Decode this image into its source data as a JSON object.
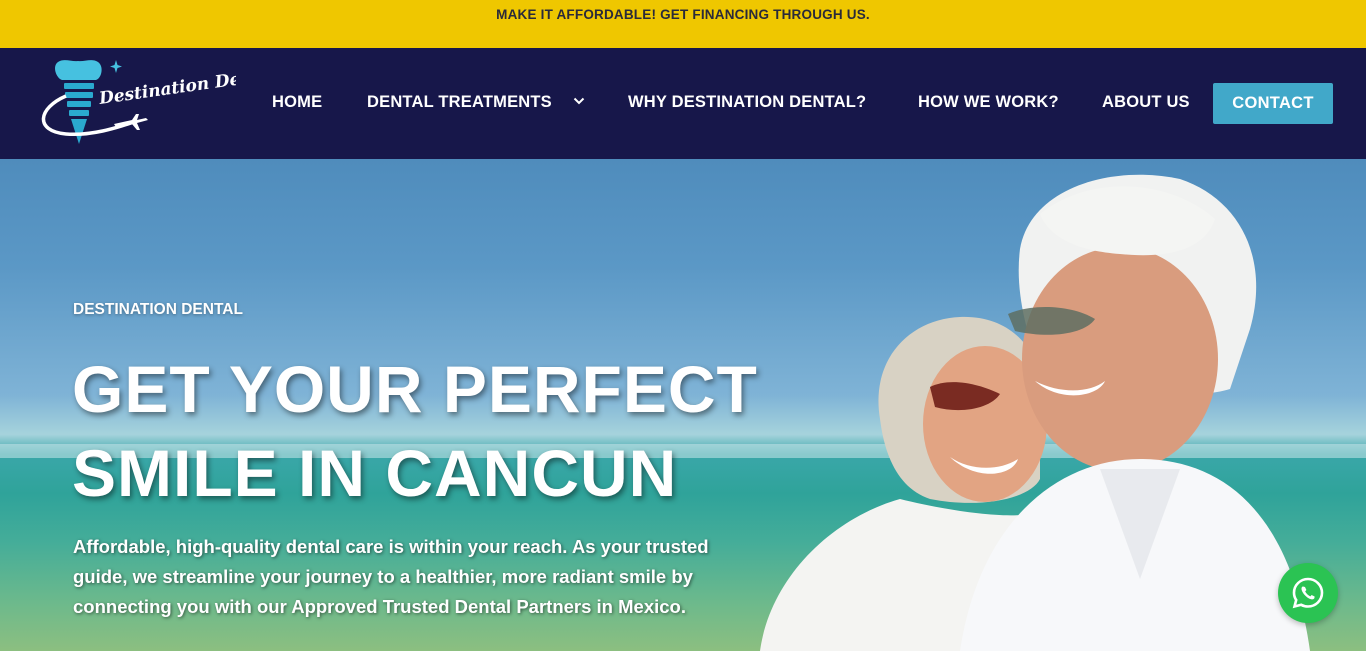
{
  "announcement": {
    "text": "MAKE IT AFFORDABLE! GET FINANCING THROUGH US."
  },
  "brand": {
    "name": "Destination Dental"
  },
  "nav": {
    "items": [
      {
        "label": "HOME"
      },
      {
        "label": "DENTAL TREATMENTS",
        "has_dropdown": true
      },
      {
        "label": "WHY DESTINATION DENTAL?"
      },
      {
        "label": "HOW WE WORK?"
      },
      {
        "label": "ABOUT US"
      }
    ],
    "contact_label": "CONTACT"
  },
  "hero": {
    "eyebrow": "DESTINATION DENTAL",
    "headline_line1": "GET YOUR PERFECT",
    "headline_line2": "SMILE IN CANCUN",
    "subtext": "Affordable, high-quality dental care is within your reach. As your trusted guide, we streamline your journey to a healthier, more radiant smile by connecting you with our Approved Trusted Dental Partners in Mexico."
  },
  "colors": {
    "announcement_bg": "#efc700",
    "nav_bg": "#17174a",
    "contact_bg": "#41a8c9",
    "whatsapp_bg": "#2bc353"
  },
  "icons": {
    "dropdown": "chevron-down-icon",
    "chat": "whatsapp-icon"
  }
}
